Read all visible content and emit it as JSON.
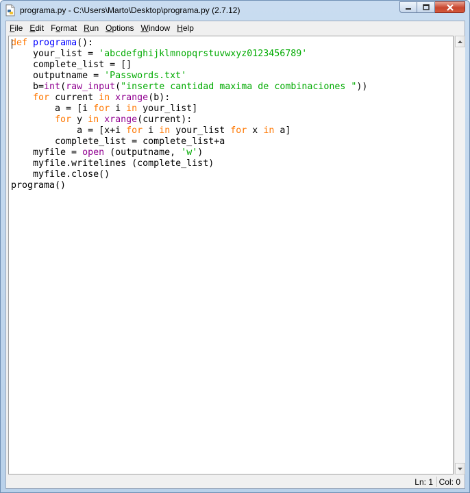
{
  "window": {
    "title": "programa.py - C:\\Users\\Marto\\Desktop\\programa.py (2.7.12)",
    "icons": {
      "app": "python-file-icon",
      "minimize": "minimize-icon",
      "maximize": "maximize-icon",
      "close": "close-icon"
    }
  },
  "menu": [
    {
      "u": "F",
      "rest": "ile"
    },
    {
      "u": "E",
      "rest": "dit"
    },
    {
      "u": "",
      "pre": "F",
      "u2": "o",
      "rest": "rmat"
    },
    {
      "u": "R",
      "rest": "un"
    },
    {
      "u": "O",
      "rest": "ptions"
    },
    {
      "u": "W",
      "rest": "indow"
    },
    {
      "u": "H",
      "rest": "elp"
    }
  ],
  "editor": {
    "lines": [
      [
        {
          "t": "def",
          "c": "kw"
        },
        {
          "t": " "
        },
        {
          "t": "programa",
          "c": "def"
        },
        {
          "t": "():"
        }
      ],
      [
        {
          "t": "    your_list = "
        },
        {
          "t": "'abcdefghijklmnopqrstuvwxyz0123456789'",
          "c": "str"
        }
      ],
      [
        {
          "t": "    complete_list = []"
        }
      ],
      [
        {
          "t": "    outputname = "
        },
        {
          "t": "'Passwords.txt'",
          "c": "str"
        }
      ],
      [
        {
          "t": "    b="
        },
        {
          "t": "int",
          "c": "bi"
        },
        {
          "t": "("
        },
        {
          "t": "raw_input",
          "c": "bi"
        },
        {
          "t": "("
        },
        {
          "t": "\"inserte cantidad maxima de combinaciones \"",
          "c": "str"
        },
        {
          "t": "))"
        }
      ],
      [
        {
          "t": "    "
        },
        {
          "t": "for",
          "c": "kw"
        },
        {
          "t": " current "
        },
        {
          "t": "in",
          "c": "kw"
        },
        {
          "t": " "
        },
        {
          "t": "xrange",
          "c": "bi"
        },
        {
          "t": "(b):"
        }
      ],
      [
        {
          "t": "        a = [i "
        },
        {
          "t": "for",
          "c": "kw"
        },
        {
          "t": " i "
        },
        {
          "t": "in",
          "c": "kw"
        },
        {
          "t": " your_list]"
        }
      ],
      [
        {
          "t": "        "
        },
        {
          "t": "for",
          "c": "kw"
        },
        {
          "t": " y "
        },
        {
          "t": "in",
          "c": "kw"
        },
        {
          "t": " "
        },
        {
          "t": "xrange",
          "c": "bi"
        },
        {
          "t": "(current):"
        }
      ],
      [
        {
          "t": "            a = [x+i "
        },
        {
          "t": "for",
          "c": "kw"
        },
        {
          "t": " i "
        },
        {
          "t": "in",
          "c": "kw"
        },
        {
          "t": " your_list "
        },
        {
          "t": "for",
          "c": "kw"
        },
        {
          "t": " x "
        },
        {
          "t": "in",
          "c": "kw"
        },
        {
          "t": " a]"
        }
      ],
      [
        {
          "t": "        complete_list = complete_list+a"
        }
      ],
      [
        {
          "t": "    myfile = "
        },
        {
          "t": "open",
          "c": "bi"
        },
        {
          "t": " (outputname, "
        },
        {
          "t": "'w'",
          "c": "str"
        },
        {
          "t": ")"
        }
      ],
      [
        {
          "t": "    myfile.writelines (complete_list)"
        }
      ],
      [
        {
          "t": "    myfile.close()"
        }
      ],
      [
        {
          "t": "programa()"
        }
      ]
    ]
  },
  "status": {
    "line": "Ln: 1",
    "col": "Col: 0"
  },
  "colors": {
    "keyword": "#ff7700",
    "definition": "#0000ff",
    "builtin": "#900090",
    "string": "#00aa00"
  }
}
